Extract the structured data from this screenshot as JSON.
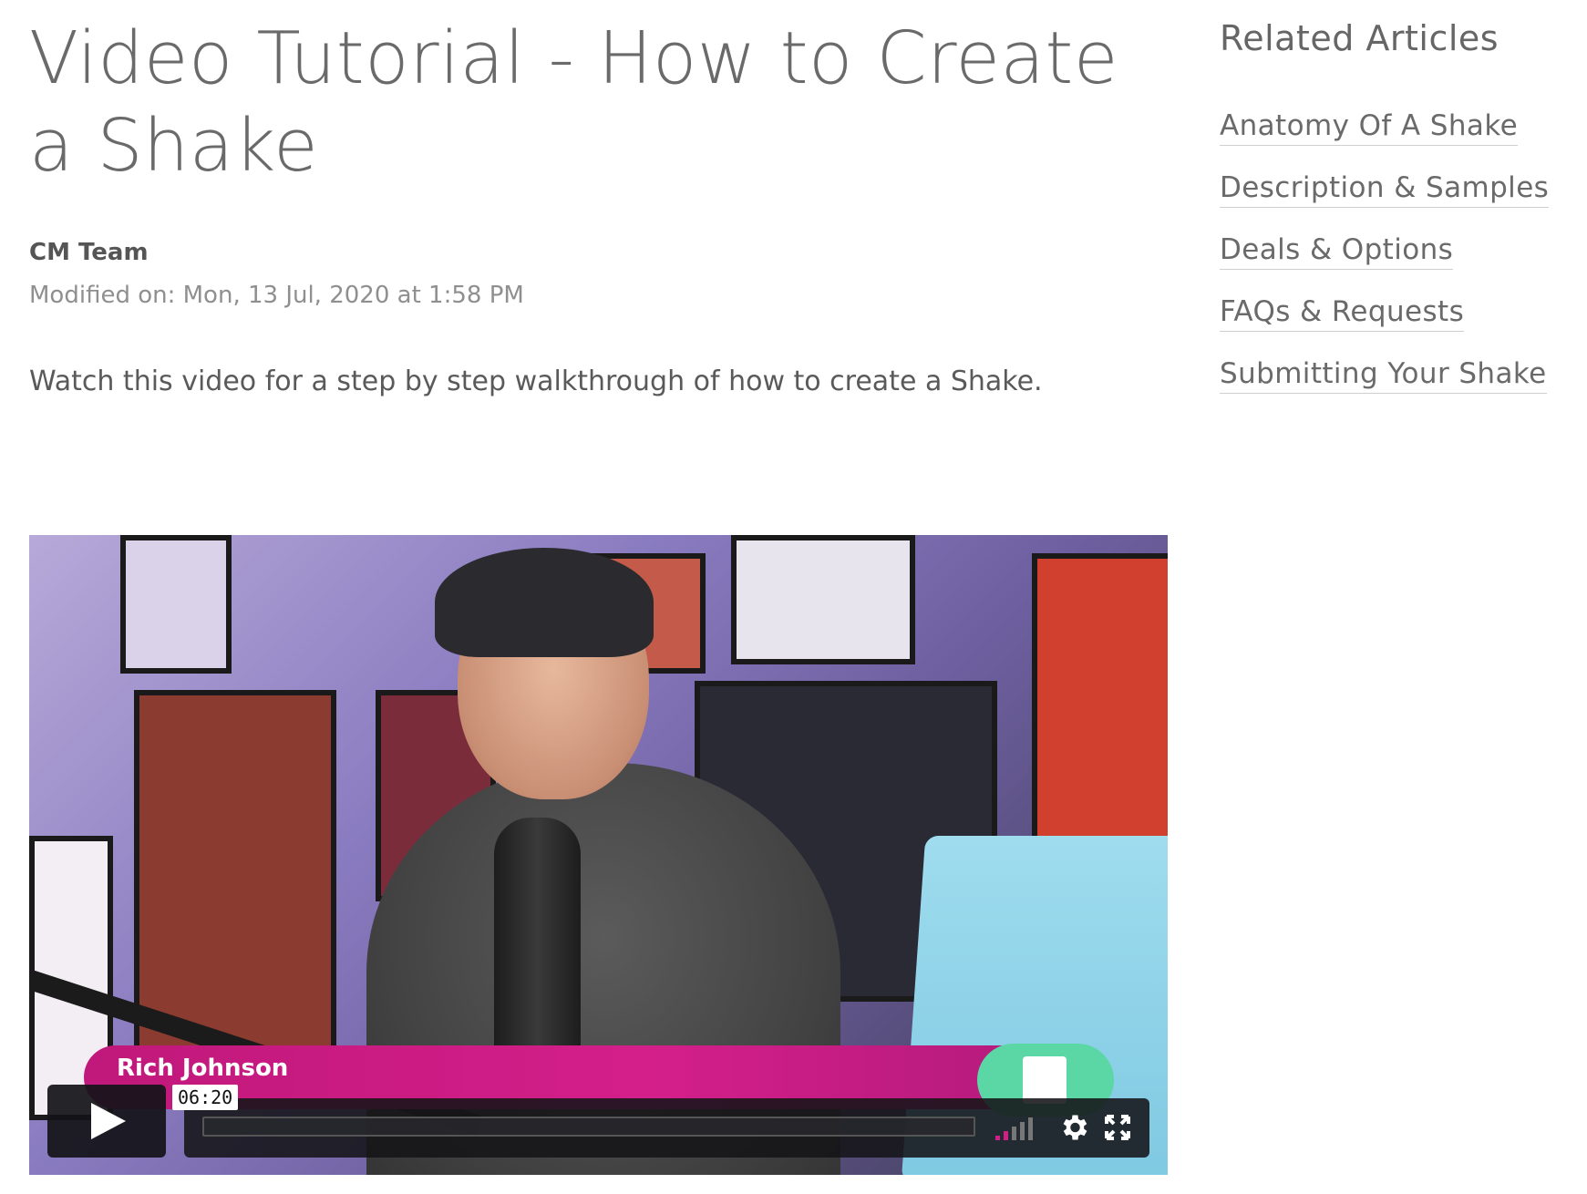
{
  "article": {
    "title_line1": "Video Tutorial - How to Create",
    "title_line2": "a Shake",
    "author": "CM Team",
    "modified": "Modified on: Mon, 13 Jul, 2020 at 1:58 PM",
    "description": "Watch this video for a step by step walkthrough of how to create a Shake."
  },
  "video": {
    "presenter_name": "Rich Johnson",
    "hover_time": "06:20",
    "progress": 0.0,
    "icons": {
      "play": "play-icon",
      "volume": "volume-icon",
      "settings": "gear-icon",
      "fullscreen": "fullscreen-icon"
    }
  },
  "related": {
    "title": "Related Articles",
    "items": [
      {
        "label": "Anatomy Of A Shake"
      },
      {
        "label": "Description & Samples"
      },
      {
        "label": "Deals & Options"
      },
      {
        "label": "FAQs & Requests"
      },
      {
        "label": "Submitting Your Shake"
      }
    ]
  }
}
